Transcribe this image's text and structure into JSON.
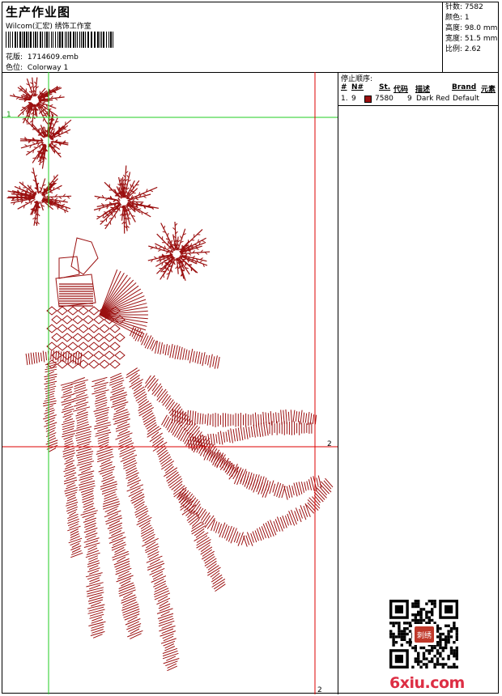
{
  "header": {
    "title": "生产作业图",
    "subtitle": "Wilcom(汇宏) 绣饰工作室",
    "design_label": "花版:",
    "design_value": "1714609.emb",
    "colorway_label": "色位:",
    "colorway_value": "Colorway 1"
  },
  "stats": {
    "stitches_label": "针数:",
    "stitches_value": "7582",
    "colors_label": "颜色:",
    "colors_value": "1",
    "height_label": "高度:",
    "height_value": "98.0 mm",
    "width_label": "宽度:",
    "width_value": "51.5 mm",
    "ratio_label": "比例:",
    "ratio_value": "2.62"
  },
  "stop_sequence": {
    "title": "停止顺序:",
    "columns": [
      "#",
      "N#",
      "St.",
      "代码",
      "描述",
      "Brand",
      "元素"
    ],
    "rows": [
      {
        "index": "1.",
        "needle": "9",
        "color": "#9b1010",
        "stitches": "7580",
        "code": "9",
        "description": "Dark Red",
        "brand": "Default",
        "element": ""
      }
    ]
  },
  "guides": {
    "green_marker_label": "1",
    "red_marker_label_right": "2",
    "red_marker_label_bottom": "2"
  },
  "design_color": "#9b1010",
  "watermark": {
    "text": "6xiu.com",
    "color": "#dd2e44"
  },
  "qr_badge_text": "刺绣"
}
